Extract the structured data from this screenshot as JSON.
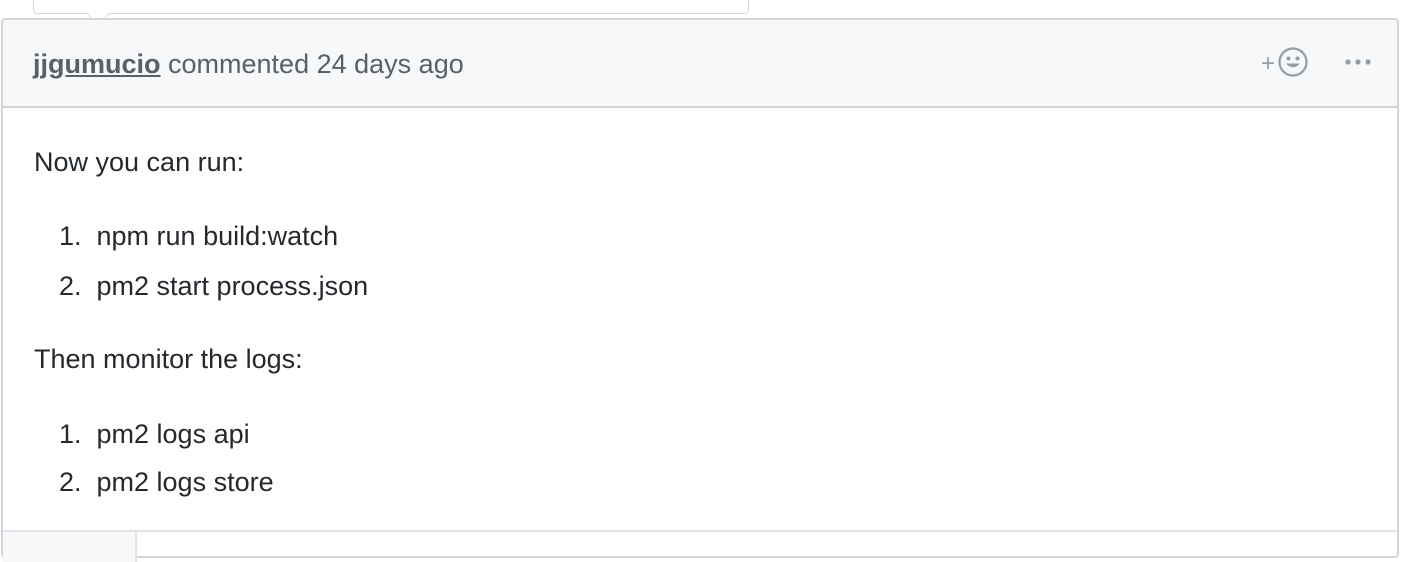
{
  "comment": {
    "author": "jjgumucio",
    "action": "commented",
    "time": "24 days ago",
    "reaction_plus": "+",
    "reaction_icon": "smiley-icon",
    "more_label": "•••",
    "intro": "Now you can run:",
    "run_steps": [
      {
        "num": "1.",
        "text": "npm run build:watch"
      },
      {
        "num": "2.",
        "text": "pm2 start process.json"
      }
    ],
    "monitor_intro": "Then monitor the logs:",
    "log_steps": [
      {
        "num": "1.",
        "text": "pm2 logs api"
      },
      {
        "num": "2.",
        "text": "pm2 logs store"
      }
    ]
  },
  "colors": {
    "header_bg": "#f6f8fa",
    "border": "#d1d5da",
    "text": "#24292e",
    "muted": "#586069",
    "icon": "#959da5"
  }
}
